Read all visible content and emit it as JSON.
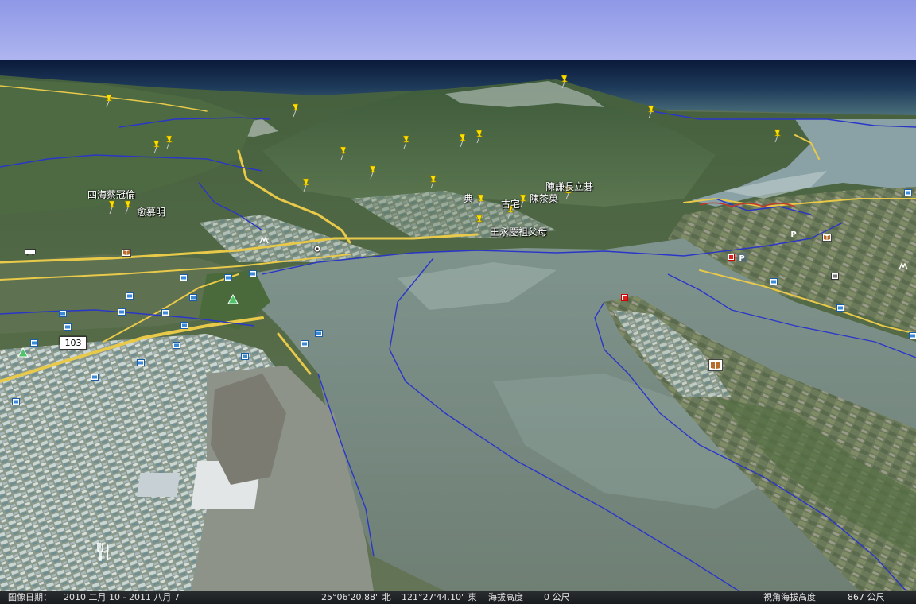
{
  "map": {
    "place_labels": [
      {
        "key": "siHai",
        "text": "四海蔡冠倫"
      },
      {
        "key": "yuMu",
        "text": "愈慕明"
      },
      {
        "key": "chenShengZ",
        "text": "陳謙長立碁"
      },
      {
        "key": "chenCaiGuo",
        "text": "陳茶菓"
      },
      {
        "key": "dian",
        "text": "典"
      },
      {
        "key": "guZhai",
        "text": "古宅"
      },
      {
        "key": "wangYong",
        "text": "王永慶祖父母"
      }
    ],
    "road_shield": "103",
    "icon_names": [
      "pushpin-icon",
      "photo-icon",
      "park-tree-icon",
      "book-icon",
      "parking-icon",
      "restaurant-icon",
      "hiking-icon",
      "bus-icon"
    ]
  },
  "statusbar": {
    "imagery_label": "圖像日期：",
    "imagery_date": "2010 二月 10 - 2011 八月 7",
    "latitude": "25°06'20.88\" 北",
    "longitude": "121°27'44.10\" 東",
    "elevation_label": "海拔高度",
    "elevation_value": "0 公尺",
    "eye_alt_label": "視角海拔高度",
    "eye_alt_value": "867 公尺"
  }
}
